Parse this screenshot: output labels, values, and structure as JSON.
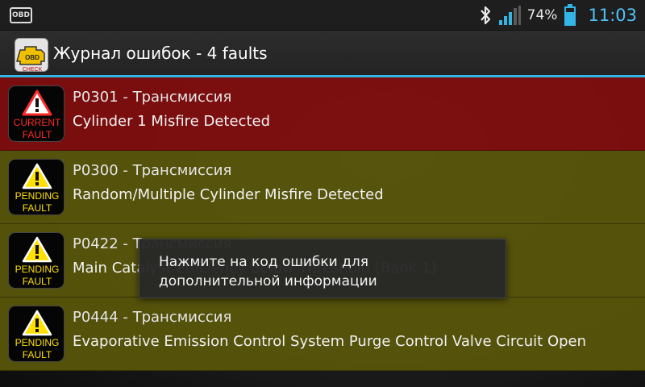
{
  "status_bar": {
    "notification_icon": "OBD",
    "battery_percent": "74%",
    "time": "11:03",
    "icons": [
      "bluetooth-icon",
      "signal-icon",
      "battery-icon"
    ]
  },
  "action_bar": {
    "app_icon": "obd-check-engine-icon",
    "app_icon_text": "OBD CHECK",
    "title": "Журнал ошибок - 4 faults"
  },
  "faults": [
    {
      "status": "current",
      "badge_line1": "CURRENT",
      "badge_line2": "FAULT",
      "code": "P0301 - Трансмиссия",
      "description": "Cylinder 1 Misfire Detected"
    },
    {
      "status": "pending",
      "badge_line1": "PENDING",
      "badge_line2": "FAULT",
      "code": "P0300 - Трансмиссия",
      "description": "Random/Multiple Cylinder Misfire Detected"
    },
    {
      "status": "pending",
      "badge_line1": "PENDING",
      "badge_line2": "FAULT",
      "code": "P0422 - Трансмиссия",
      "description": "Main Catalyst Efficiency Below Threshold (Bank 1)"
    },
    {
      "status": "pending",
      "badge_line1": "PENDING",
      "badge_line2": "FAULT",
      "code": "P0444 - Трансмиссия",
      "description": "Evaporative Emission Control System Purge Control Valve Circuit Open"
    }
  ],
  "toast": {
    "line1": "Нажмите на код ошибки для",
    "line2": "дополнительной информации"
  },
  "colors": {
    "accent": "#33b5e5",
    "clock": "#4fc3f7",
    "current_fault_bg": "#820c0c",
    "pending_fault_bg": "#58560a",
    "current_label": "#ff2a2a",
    "pending_label": "#ffe000"
  }
}
